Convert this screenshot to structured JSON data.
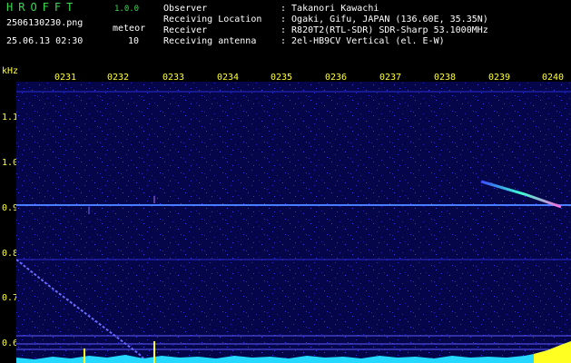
{
  "header": {
    "app_title": "HROFFT",
    "app_version": "1.0.0",
    "filename": "2506130230.png",
    "meteor_label": "meteor",
    "datetime": "25.06.13 02:30",
    "meteor_count": "10"
  },
  "info": [
    {
      "label": "Observer",
      "value": ": Takanori Kawachi"
    },
    {
      "label": "Receiving Location",
      "value": ": Ogaki, Gifu, JAPAN (136.60E, 35.35N)"
    },
    {
      "label": "Receiver",
      "value": ": R820T2(RTL-SDR) SDR-Sharp 53.1000MHz"
    },
    {
      "label": "Receiving antenna",
      "value": ": 2el-HB9CV Vertical (el. E-W)"
    }
  ],
  "axis": {
    "unit": "kHz",
    "time_ticks": [
      "0231",
      "0232",
      "0233",
      "0234",
      "0235",
      "0236",
      "0237",
      "0238",
      "0239",
      "0240"
    ],
    "freq_ticks": [
      "1.1",
      "1.0",
      "0.9",
      "0.8",
      "0.7",
      "0.6"
    ]
  },
  "colors": {
    "green": "#39d94f",
    "yellow": "#ffff33",
    "noise_bg": "#0a0a5a",
    "carrier": "#4b7bff",
    "floor": "#24d8ff"
  }
}
